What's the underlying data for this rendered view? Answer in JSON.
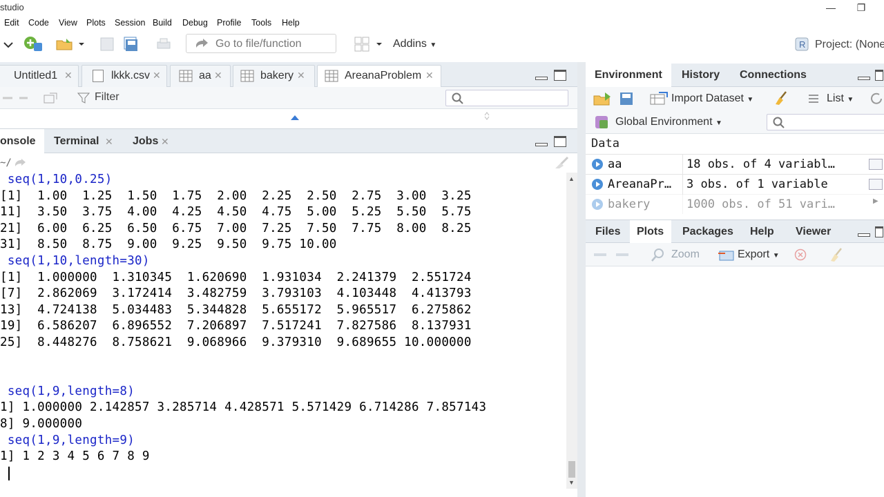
{
  "window": {
    "title": "studio"
  },
  "menu": [
    "Edit",
    "Code",
    "View",
    "Plots",
    "Session",
    "Build",
    "Debug",
    "Profile",
    "Tools",
    "Help"
  ],
  "toolbar": {
    "goto_placeholder": "Go to file/function",
    "addins_label": "Addins",
    "project_label": "Project: (None"
  },
  "source": {
    "tabs": [
      {
        "label": "Untitled1",
        "icon": "r-script-icon"
      },
      {
        "label": "lkkk.csv",
        "icon": "file-icon"
      },
      {
        "label": "aa",
        "icon": "table-icon"
      },
      {
        "label": "bakery",
        "icon": "table-icon"
      },
      {
        "label": "AreanaProblem",
        "icon": "table-icon",
        "active": true
      }
    ],
    "filter_label": "Filter"
  },
  "console": {
    "tabs": [
      {
        "label": "onsole",
        "active": true
      },
      {
        "label": "Terminal"
      },
      {
        "label": "Jobs"
      }
    ],
    "path": "~/",
    "lines": [
      {
        "text": " seq(1,10,0.25)",
        "type": "cmd"
      },
      {
        "text": "[1]  1.00  1.25  1.50  1.75  2.00  2.25  2.50  2.75  3.00  3.25",
        "type": "out"
      },
      {
        "text": "11]  3.50  3.75  4.00  4.25  4.50  4.75  5.00  5.25  5.50  5.75",
        "type": "out"
      },
      {
        "text": "21]  6.00  6.25  6.50  6.75  7.00  7.25  7.50  7.75  8.00  8.25",
        "type": "out"
      },
      {
        "text": "31]  8.50  8.75  9.00  9.25  9.50  9.75 10.00",
        "type": "out"
      },
      {
        "text": " seq(1,10,length=30)",
        "type": "cmd"
      },
      {
        "text": "[1]  1.000000  1.310345  1.620690  1.931034  2.241379  2.551724",
        "type": "out"
      },
      {
        "text": "[7]  2.862069  3.172414  3.482759  3.793103  4.103448  4.413793",
        "type": "out"
      },
      {
        "text": "13]  4.724138  5.034483  5.344828  5.655172  5.965517  6.275862",
        "type": "out"
      },
      {
        "text": "19]  6.586207  6.896552  7.206897  7.517241  7.827586  8.137931",
        "type": "out"
      },
      {
        "text": "25]  8.448276  8.758621  9.068966  9.379310  9.689655 10.000000",
        "type": "out"
      },
      {
        "text": "",
        "type": "out"
      },
      {
        "text": "",
        "type": "out"
      },
      {
        "text": " seq(1,9,length=8)",
        "type": "cmd"
      },
      {
        "text": "1] 1.000000 2.142857 3.285714 4.428571 5.571429 6.714286 7.857143",
        "type": "out"
      },
      {
        "text": "8] 9.000000",
        "type": "out"
      },
      {
        "text": " seq(1,9,length=9)",
        "type": "cmd"
      },
      {
        "text": "1] 1 2 3 4 5 6 7 8 9",
        "type": "out"
      }
    ]
  },
  "environment": {
    "tabs": [
      {
        "label": "Environment",
        "active": true
      },
      {
        "label": "History"
      },
      {
        "label": "Connections"
      }
    ],
    "import_label": "Import Dataset",
    "list_label": "List",
    "scope_label": "Global Environment",
    "section_heading": "Data",
    "rows": [
      {
        "name": "aa",
        "value": "18 obs. of 4 variabl…"
      },
      {
        "name": "AreanaPr…",
        "value": "3 obs. of 1 variable"
      },
      {
        "name": "bakery",
        "value": "1000 obs. of 51 vari…"
      }
    ]
  },
  "files": {
    "tabs": [
      {
        "label": "Files"
      },
      {
        "label": "Plots",
        "active": true
      },
      {
        "label": "Packages"
      },
      {
        "label": "Help"
      },
      {
        "label": "Viewer"
      }
    ],
    "zoom_label": "Zoom",
    "export_label": "Export"
  }
}
